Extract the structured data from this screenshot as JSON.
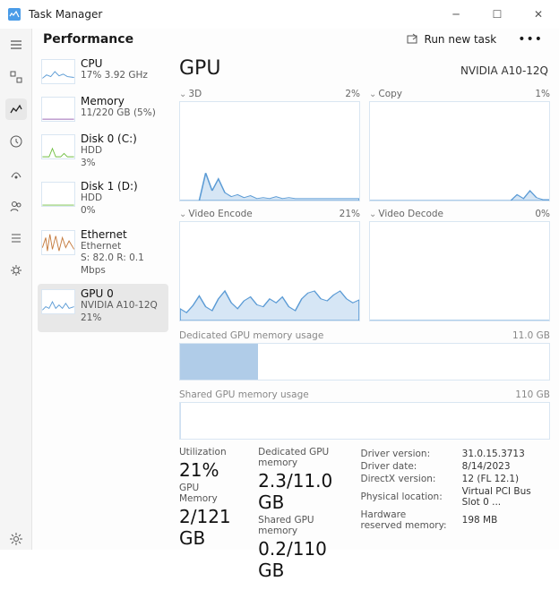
{
  "app": {
    "title": "Task Manager"
  },
  "header": {
    "page": "Performance",
    "run_new": "Run new task"
  },
  "nav_icons": [
    "menu",
    "processes",
    "performance-active",
    "history",
    "startup",
    "users",
    "details",
    "services"
  ],
  "perf_list": [
    {
      "label": "CPU",
      "sub1": "17%  3.92 GHz",
      "sub2": "",
      "selected": false
    },
    {
      "label": "Memory",
      "sub1": "11/220 GB (5%)",
      "sub2": "",
      "selected": false
    },
    {
      "label": "Disk 0 (C:)",
      "sub1": "HDD",
      "sub2": "3%",
      "selected": false
    },
    {
      "label": "Disk 1 (D:)",
      "sub1": "HDD",
      "sub2": "0%",
      "selected": false
    },
    {
      "label": "Ethernet",
      "sub1": "Ethernet",
      "sub2": "S: 82.0 R: 0.1 Mbps",
      "selected": false
    },
    {
      "label": "GPU 0",
      "sub1": "NVIDIA A10-12Q",
      "sub2": "21%",
      "selected": true
    }
  ],
  "detail": {
    "title": "GPU",
    "device": "NVIDIA A10-12Q",
    "engines": [
      {
        "name": "3D",
        "value": "2%"
      },
      {
        "name": "Copy",
        "value": "1%"
      },
      {
        "name": "Video Encode",
        "value": "21%"
      },
      {
        "name": "Video Decode",
        "value": "0%"
      }
    ],
    "dedicated_mem": {
      "label": "Dedicated GPU memory usage",
      "max": "11.0 GB",
      "pct": 21
    },
    "shared_mem": {
      "label": "Shared GPU memory usage",
      "max": "110 GB",
      "pct": 0.2
    },
    "stats_left": [
      {
        "lab": "Utilization",
        "big": "21%"
      },
      {
        "lab": "GPU Memory",
        "big": "2/121 GB"
      }
    ],
    "stats_mid": [
      {
        "lab": "Dedicated GPU memory",
        "big": "2.3/11.0 GB"
      },
      {
        "lab": "Shared GPU memory",
        "big": "0.2/110 GB"
      }
    ],
    "details_table": [
      [
        "Driver version:",
        "31.0.15.3713"
      ],
      [
        "Driver date:",
        "8/14/2023"
      ],
      [
        "DirectX version:",
        "12 (FL 12.1)"
      ],
      [
        "Physical location:",
        "Virtual PCI Bus Slot 0 ..."
      ],
      [
        "Hardware reserved memory:",
        "198 MB"
      ]
    ]
  },
  "chart_data": [
    {
      "type": "area",
      "title": "3D",
      "value_pct": 2,
      "ylim": [
        0,
        100
      ],
      "series": [
        {
          "name": "usage",
          "values": [
            0,
            0,
            0,
            0,
            28,
            10,
            22,
            8,
            4,
            6,
            3,
            5,
            2,
            3,
            2,
            4,
            2,
            3,
            2,
            2,
            2,
            2,
            2,
            2,
            2,
            2,
            2,
            2,
            2
          ]
        }
      ]
    },
    {
      "type": "area",
      "title": "Copy",
      "value_pct": 1,
      "ylim": [
        0,
        100
      ],
      "series": [
        {
          "name": "usage",
          "values": [
            0,
            0,
            0,
            0,
            0,
            0,
            0,
            0,
            0,
            0,
            0,
            0,
            0,
            0,
            0,
            0,
            0,
            0,
            0,
            0,
            0,
            0,
            0,
            6,
            2,
            10,
            3,
            1,
            1
          ]
        }
      ]
    },
    {
      "type": "area",
      "title": "Video Encode",
      "value_pct": 21,
      "ylim": [
        0,
        100
      ],
      "series": [
        {
          "name": "usage",
          "values": [
            12,
            8,
            15,
            25,
            14,
            10,
            22,
            30,
            18,
            12,
            20,
            24,
            16,
            14,
            22,
            18,
            24,
            14,
            10,
            22,
            28,
            30,
            22,
            20,
            26,
            30,
            22,
            18,
            21
          ]
        }
      ]
    },
    {
      "type": "area",
      "title": "Video Decode",
      "value_pct": 0,
      "ylim": [
        0,
        100
      ],
      "series": [
        {
          "name": "usage",
          "values": [
            0,
            0,
            0,
            0,
            0,
            0,
            0,
            0,
            0,
            0,
            0,
            0,
            0,
            0,
            0,
            0,
            0,
            0,
            0,
            0,
            0,
            0,
            0,
            0,
            0,
            0,
            0,
            0,
            0
          ]
        }
      ]
    }
  ]
}
